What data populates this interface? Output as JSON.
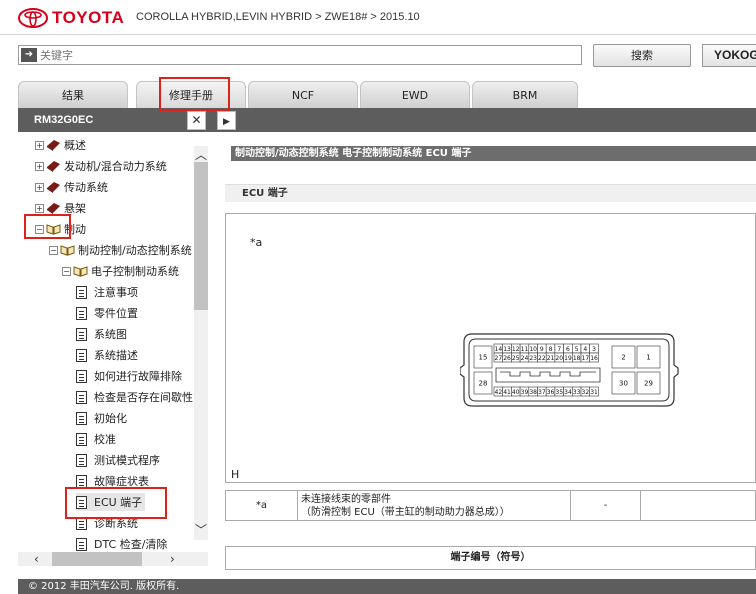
{
  "header": {
    "brand": "TOYOTA",
    "breadcrumb": "COROLLA HYBRID,LEVIN HYBRID > ZWE18# > 2015.10"
  },
  "search": {
    "placeholder": "关键字",
    "button": "搜索",
    "extra_button": "YOKOG"
  },
  "tabs": [
    {
      "label": "结果"
    },
    {
      "label": "修理手册"
    },
    {
      "label": "NCF"
    },
    {
      "label": "EWD"
    },
    {
      "label": "BRM"
    }
  ],
  "doc_id": "RM32G0EC",
  "tree": [
    {
      "label": "概述"
    },
    {
      "label": "发动机/混合动力系统"
    },
    {
      "label": "传动系统"
    },
    {
      "label": "悬架"
    },
    {
      "label": "制动"
    },
    {
      "label": "制动控制/动态控制系统"
    },
    {
      "label": "电子控制制动系统"
    },
    {
      "label": "注意事项"
    },
    {
      "label": "零件位置"
    },
    {
      "label": "系统图"
    },
    {
      "label": "系统描述"
    },
    {
      "label": "如何进行故障排除"
    },
    {
      "label": "检查是否存在间歇性"
    },
    {
      "label": "初始化"
    },
    {
      "label": "校准"
    },
    {
      "label": "测试模式程序"
    },
    {
      "label": "故障症状表"
    },
    {
      "label": "ECU 端子"
    },
    {
      "label": "诊断系统"
    },
    {
      "label": "DTC 检查/清除"
    }
  ],
  "content": {
    "title": "制动控制/动态控制系统  电子控制制动系统  ECU 端子",
    "section": "ECU 端子",
    "fig_callout": "*a",
    "fig_letter": "H",
    "connector": {
      "top_pins": [
        "14",
        "13",
        "12",
        "11",
        "10",
        "9",
        "8",
        "7",
        "6",
        "5",
        "4",
        "3"
      ],
      "mid_pins": [
        "27",
        "26",
        "25",
        "24",
        "23",
        "22",
        "21",
        "20",
        "19",
        "18",
        "17",
        "16"
      ],
      "bottom_pins": [
        "42",
        "41",
        "40",
        "39",
        "38",
        "37",
        "36",
        "35",
        "34",
        "33",
        "32",
        "31"
      ],
      "left_pins": [
        "15",
        "28"
      ],
      "right_pins": [
        "2",
        "1",
        "30",
        "29"
      ]
    },
    "legend_key": "*a",
    "legend_text_1": "未连接线束的零部件",
    "legend_text_2": "（防滑控制 ECU（带主缸的制动助力器总成））",
    "legend_dash": "-",
    "table_header": "端子编号（符号）"
  },
  "footer": "© 2012 丰田汽车公司. 版权所有."
}
